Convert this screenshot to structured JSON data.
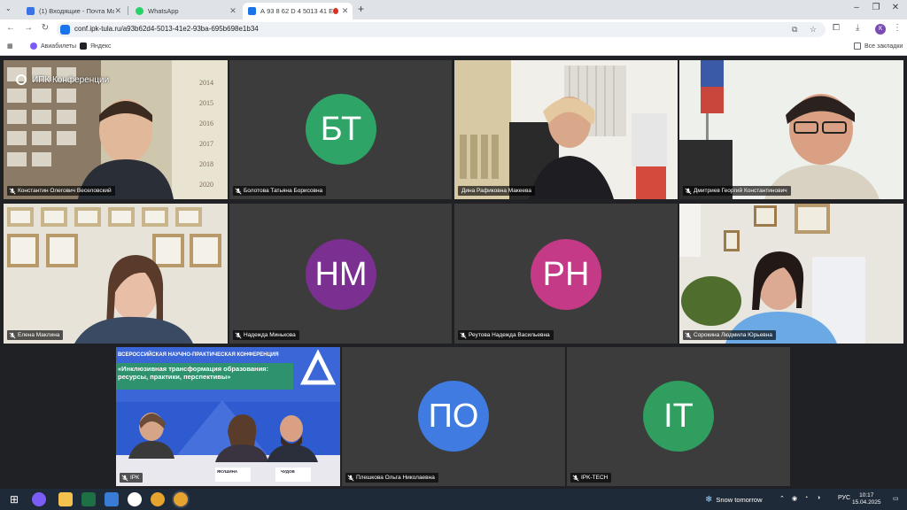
{
  "browser": {
    "tabs": [
      {
        "title": "(1) Входящие - Почта Mail",
        "favicon_color": "#3b73e6"
      },
      {
        "title": "WhatsApp",
        "favicon_color": "#25d366"
      },
      {
        "title": "А 93 8 62 D 4 5013 41 Е 2 9",
        "favicon_color": "#1a73e8",
        "active": true
      }
    ],
    "url": "conf.ipk-tula.ru/a93b62d4-5013-41e2-93ba-695b698e1b34",
    "profile_letter": "К",
    "bookmarks": [
      {
        "label": "Авиабилеты",
        "color": "#7b5cf5"
      },
      {
        "label": "Яндекс",
        "color": "#202124"
      }
    ],
    "all_bookmarks_label": "Все закладки"
  },
  "conference": {
    "logo_text": "ИПК Конференции",
    "participants": [
      {
        "name": "Константин Олегович Веселовский",
        "type": "video",
        "muted": true
      },
      {
        "name": "Болотова Татьяна Борисовна",
        "type": "avatar",
        "initials": "БТ",
        "color": "#2fa467",
        "muted": true
      },
      {
        "name": "Дина Рафиковна Макеева",
        "type": "video",
        "muted": false,
        "speaking": true
      },
      {
        "name": "Дмитриев Георгий Константинович",
        "type": "video",
        "muted": true
      },
      {
        "name": "Елена Маклина",
        "type": "video",
        "muted": true
      },
      {
        "name": "Надежда Минькова",
        "type": "avatar",
        "initials": "НМ",
        "color": "#7b2f91",
        "muted": true
      },
      {
        "name": "Реутова Надежда Васильевна",
        "type": "avatar",
        "initials": "РН",
        "color": "#c53a86",
        "muted": true
      },
      {
        "name": "Сорокина Людмила Юрьевна",
        "type": "video",
        "muted": true
      },
      {
        "name": "IPK",
        "type": "video",
        "muted": true
      },
      {
        "name": "Плешкова Ольга Николаевна",
        "type": "avatar",
        "initials": "ПО",
        "color": "#3f7be0",
        "muted": true
      },
      {
        "name": "IPK-TECH",
        "type": "avatar",
        "initials": "IT",
        "color": "#2f9e5f",
        "muted": true
      }
    ],
    "wall_years": [
      "2014",
      "2015",
      "2016",
      "2017",
      "2018",
      "2020"
    ],
    "banner": {
      "line1": "ВСЕРОССИЙСКАЯ НАУЧНО-ПРАКТИЧЕСКАЯ КОНФЕРЕНЦИЯ",
      "line2": "«Инклюзивная трансформация образования:",
      "line3": "ресурсы, практики, перспективы»",
      "nameplate1": "ЯКУШИНА",
      "nameplate2": "ЧУДОВ"
    }
  },
  "taskbar": {
    "weather": "Snow tomorrow",
    "lang": "РУС",
    "time": "10:17",
    "date": "15.04.2025"
  }
}
